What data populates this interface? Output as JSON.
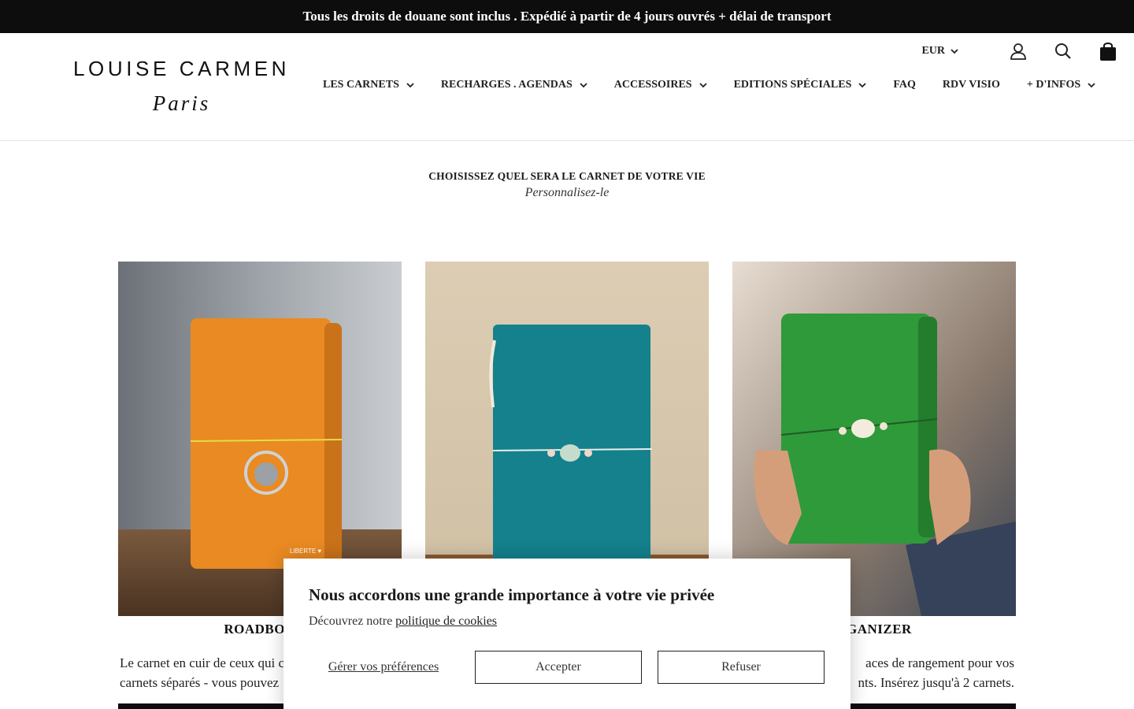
{
  "announcement": "Tous les droits de douane sont inclus . Expédié à partir de 4 jours ouvrés + délai de transport",
  "logo": {
    "name": "LOUISE CARMEN",
    "city": "Paris"
  },
  "header": {
    "currency": "EUR",
    "icons": [
      "account-icon",
      "search-icon",
      "cart-icon"
    ]
  },
  "nav": [
    {
      "label": "LES CARNETS",
      "dropdown": true
    },
    {
      "label": "RECHARGES . AGENDAS",
      "dropdown": true
    },
    {
      "label": "ACCESSOIRES",
      "dropdown": true
    },
    {
      "label": "EDITIONS SPÉCIALES",
      "dropdown": true
    },
    {
      "label": "FAQ",
      "dropdown": false
    },
    {
      "label": "RDV VISIO",
      "dropdown": false
    },
    {
      "label": "+ D'INFOS",
      "dropdown": true
    }
  ],
  "intro": {
    "title": "CHOISISSEZ QUEL SERA LE CARNET DE VOTRE VIE",
    "subtitle": "Personnalisez-le"
  },
  "products": [
    {
      "title": "ROADBOO",
      "desc": "Le carnet en cuir de ceux qui c",
      "desc2": "carnets séparés - vous pouvez",
      "color": "#e98a22",
      "image_label": "LIBERTE ♥"
    },
    {
      "title": "",
      "desc": "",
      "desc2": "",
      "color": "#14818d"
    },
    {
      "title": "RGANIZER",
      "desc": "aces de rangement pour vos",
      "desc2": "nts.  Insérez jusqu'à 2 carnets.",
      "color": "#2e9a3a"
    }
  ],
  "cookie": {
    "title": "Nous accordons une grande importance à votre vie privée",
    "text": "Découvrez notre",
    "link": "politique de cookies",
    "manage": "Gérer vos préférences",
    "accept": "Accepter",
    "refuse": "Refuser"
  }
}
